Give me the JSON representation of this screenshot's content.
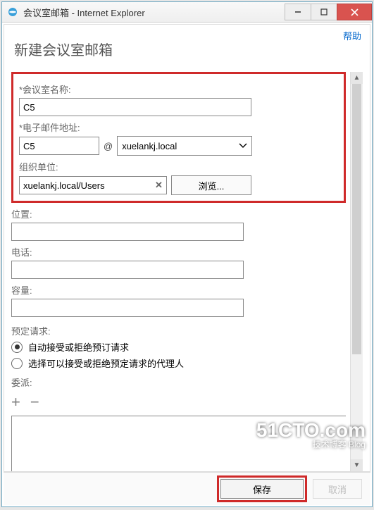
{
  "window": {
    "title": "会议室邮箱 - Internet Explorer"
  },
  "header": {
    "help": "帮助",
    "page_title": "新建会议室邮箱"
  },
  "fields": {
    "room_name_label": "*会议室名称:",
    "room_name_value": "C5",
    "email_label": "*电子邮件地址:",
    "email_alias": "C5",
    "at_symbol": "@",
    "email_domain": "xuelankj.local",
    "ou_label": "组织单位:",
    "ou_value": "xuelankj.local/Users",
    "browse_label": "浏览...",
    "location_label": "位置:",
    "location_value": "",
    "phone_label": "电话:",
    "phone_value": "",
    "capacity_label": "容量:",
    "capacity_value": "",
    "booking_label": "预定请求:",
    "booking_auto": "自动接受或拒绝预订请求",
    "booking_delegate": "选择可以接受或拒绝预定请求的代理人",
    "delegate_label": "委派:"
  },
  "buttons": {
    "save": "保存",
    "cancel": "取消"
  },
  "watermark": {
    "main": "51CTO.com",
    "sub": "技术博客   Blog"
  }
}
